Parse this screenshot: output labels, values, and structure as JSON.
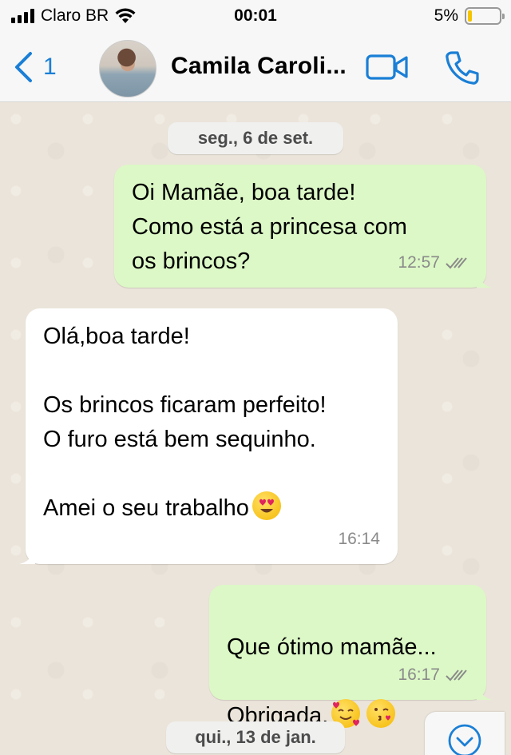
{
  "status_bar": {
    "carrier": "Claro BR",
    "time": "00:01",
    "battery_percent": "5%",
    "battery_level": 0.05,
    "battery_color": "#f5c400"
  },
  "header": {
    "back_count": "1",
    "contact_name": "Camila Caroli...",
    "icons": [
      "chevron-left-icon",
      "video-call-icon",
      "phone-icon"
    ],
    "accent_color": "#1a7fd6"
  },
  "chat": {
    "dates": [
      "seg., 6 de set.",
      "qui., 13 de jan."
    ],
    "messages": [
      {
        "direction": "outgoing",
        "text": "Oi Mamãe, boa tarde!\nComo está a princesa com\nos brincos?",
        "time": "12:57",
        "status": "read"
      },
      {
        "direction": "incoming",
        "text": "Olá,boa tarde!\n\nOs brincos ficaram perfeito!\nO furo está bem sequinho.\n\nAmei o seu trabalho",
        "emoji": "heart-eyes-emoji",
        "time": "16:14"
      },
      {
        "direction": "outgoing",
        "text_line1": "Que ótimo mamãe...",
        "text_line2": "Obrigada.",
        "emojis": [
          "smiling-face-with-hearts-emoji",
          "kissing-heart-emoji"
        ],
        "time": "16:17",
        "status": "read"
      }
    ],
    "outgoing_color": "#dcf8c6",
    "incoming_color": "#ffffff"
  }
}
